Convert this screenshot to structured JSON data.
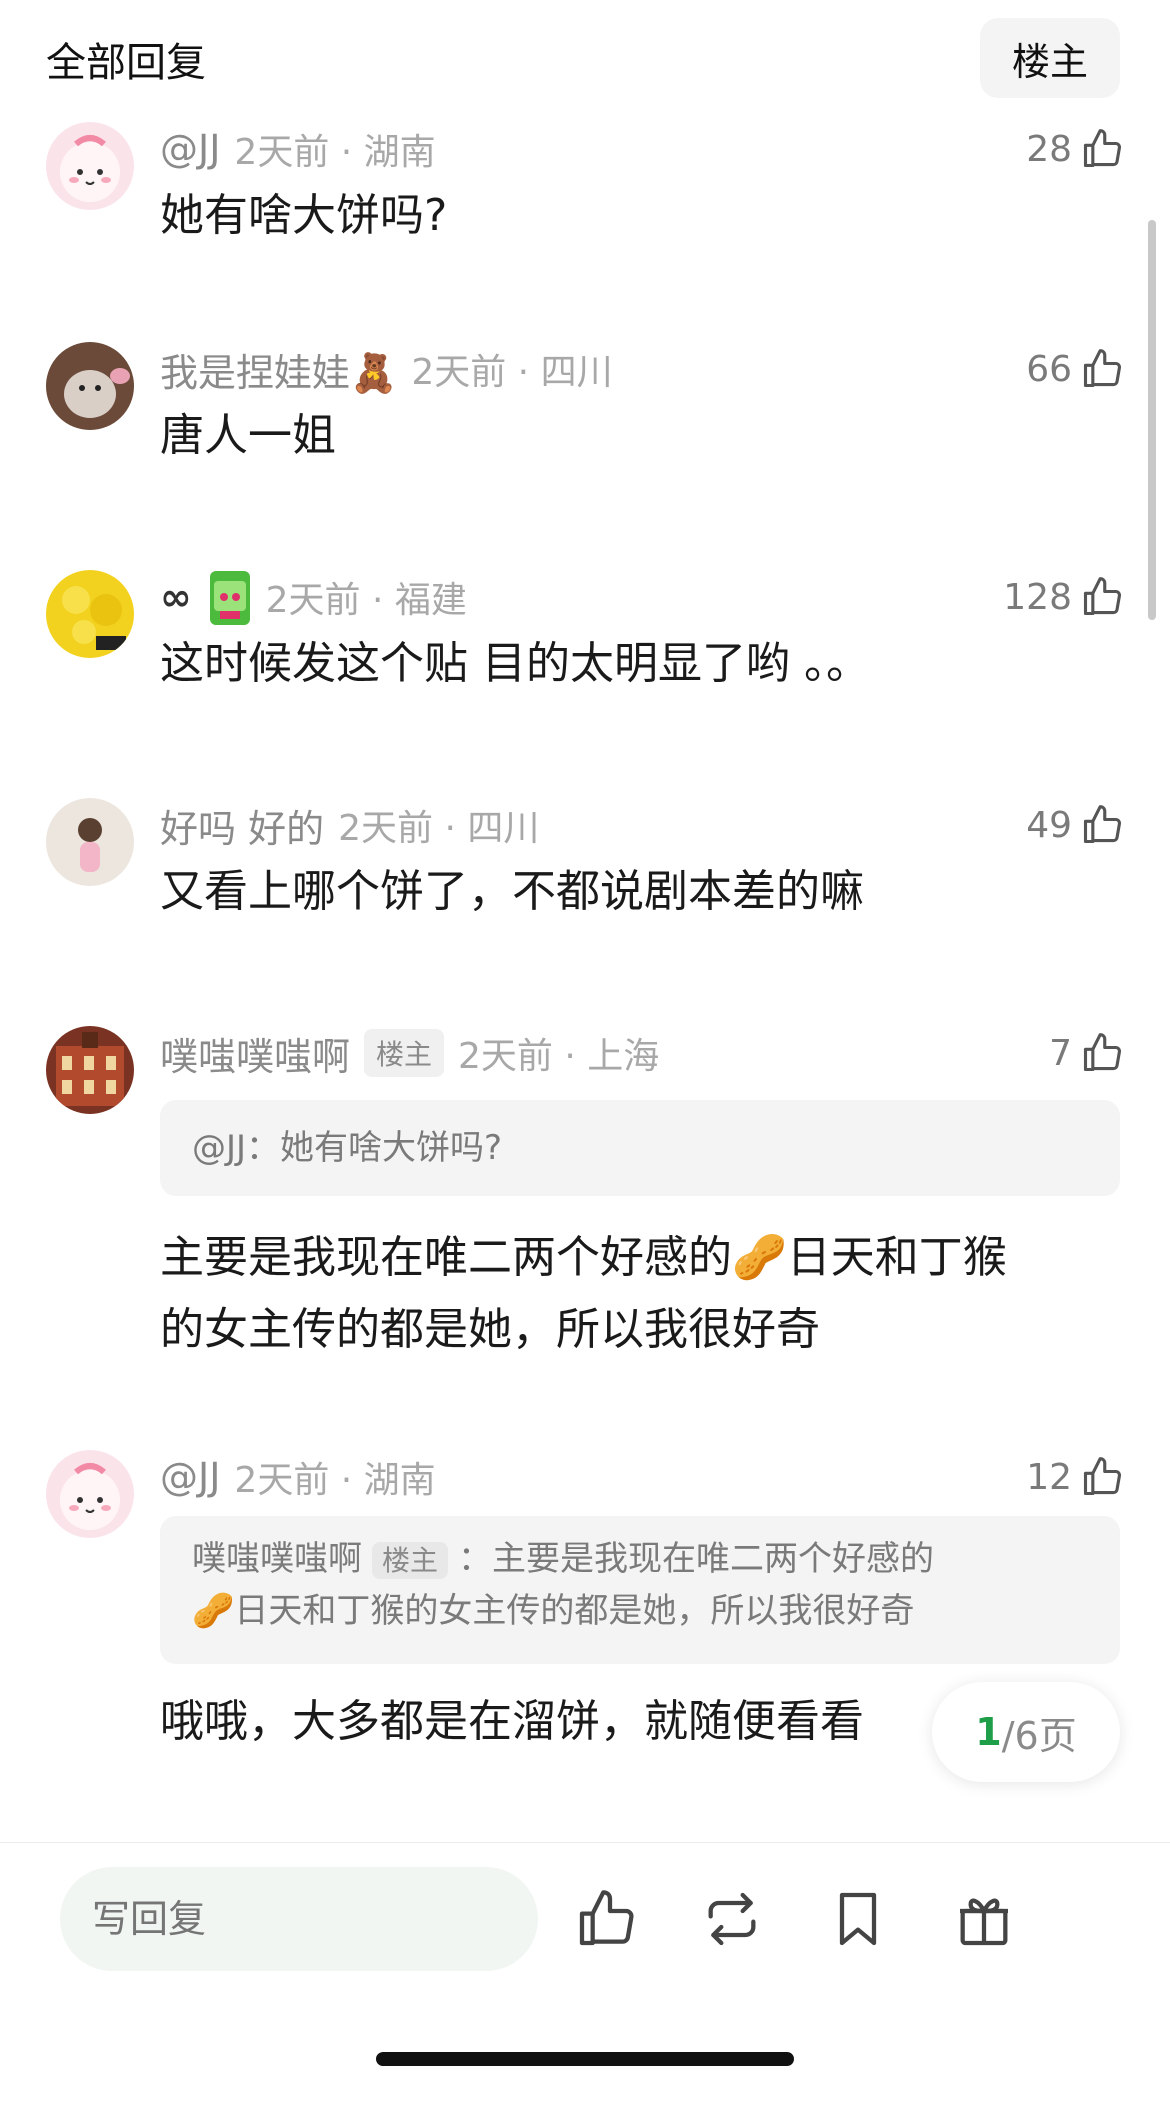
{
  "header": {
    "title": "全部回复",
    "op_button": "楼主"
  },
  "comments": [
    {
      "user": "@JJ",
      "time_location": "2天前 · 湖南",
      "likes": "28",
      "text": "她有啥大饼吗?"
    },
    {
      "user": "我是捏娃娃🧸",
      "time_location": "2天前 · 四川",
      "likes": "66",
      "text": "唐人一姐"
    },
    {
      "user": "∞",
      "time_location": "2天前 · 福建",
      "likes": "128",
      "text": "这时候发这个贴 目的太明显了哟 。。"
    },
    {
      "user": "好吗 好的",
      "time_location": "2天前 · 四川",
      "likes": "49",
      "text": "又看上哪个饼了，不都说剧本差的嘛"
    },
    {
      "user": "噗嗤噗嗤啊",
      "op_tag": "楼主",
      "time_location": "2天前 · 上海",
      "likes": "7",
      "quote": "@JJ：她有啥大饼吗?",
      "text_line1": "主要是我现在唯二两个好感的🥜日天和丁猴",
      "text_line2": "的女主传的都是她，所以我很好奇"
    },
    {
      "user": "@JJ",
      "time_location": "2天前 · 湖南",
      "likes": "12",
      "quote_user": "噗嗤噗嗤啊",
      "quote_tag": "楼主",
      "quote_line1": "：主要是我现在唯二两个好感的",
      "quote_line2": "🥜日天和丁猴的女主传的都是她，所以我很好奇",
      "text": "哦哦，大多都是在溜饼，就随便看看"
    }
  ],
  "pager": {
    "current": "1",
    "total": "/6页"
  },
  "bottom_bar": {
    "reply_placeholder": "写回复"
  }
}
